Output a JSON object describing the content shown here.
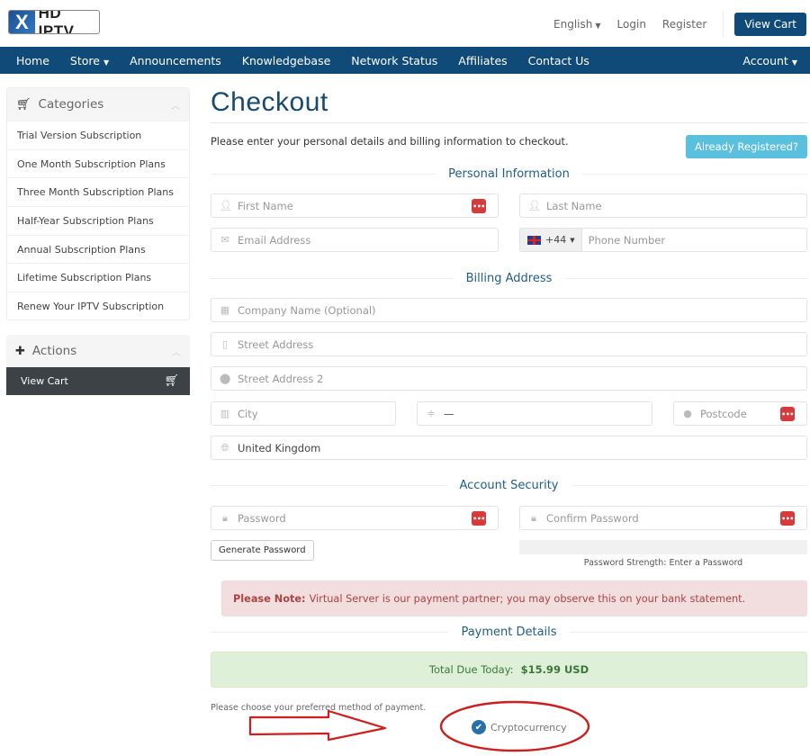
{
  "brand": {
    "logo_mark": "X",
    "logo_text": "HD IPTV"
  },
  "topbar": {
    "language": "English",
    "login": "Login",
    "register": "Register",
    "view_cart": "View Cart"
  },
  "nav": {
    "items": [
      {
        "label": "Home",
        "dropdown": false
      },
      {
        "label": "Store",
        "dropdown": true
      },
      {
        "label": "Announcements",
        "dropdown": false
      },
      {
        "label": "Knowledgebase",
        "dropdown": false
      },
      {
        "label": "Network Status",
        "dropdown": false
      },
      {
        "label": "Affiliates",
        "dropdown": false
      },
      {
        "label": "Contact Us",
        "dropdown": false
      }
    ],
    "account": "Account"
  },
  "sidebar": {
    "categories": {
      "title": "Categories",
      "items": [
        "Trial Version Subscription",
        "One Month Subscription Plans",
        "Three Month Subscription Plans",
        "Half-Year Subscription Plans",
        "Annual Subscription Plans",
        "Lifetime Subscription Plans",
        "Renew Your IPTV Subscription"
      ]
    },
    "actions": {
      "title": "Actions",
      "items": [
        "View Cart"
      ]
    }
  },
  "checkout": {
    "title": "Checkout",
    "intro": "Please enter your personal details and billing information to checkout.",
    "already_registered": "Already Registered?",
    "sections": {
      "personal": "Personal Information",
      "billing": "Billing Address",
      "security": "Account Security",
      "payment": "Payment Details"
    },
    "fields": {
      "first_name": {
        "placeholder": "First Name",
        "value": ""
      },
      "last_name": {
        "placeholder": "Last Name",
        "value": ""
      },
      "email": {
        "placeholder": "Email Address",
        "value": ""
      },
      "phone": {
        "country_code": "+44",
        "placeholder": "Phone Number",
        "value": ""
      },
      "company": {
        "placeholder": "Company Name (Optional)",
        "value": ""
      },
      "street": {
        "placeholder": "Street Address",
        "value": ""
      },
      "street2": {
        "placeholder": "Street Address 2",
        "value": ""
      },
      "city": {
        "placeholder": "City",
        "value": ""
      },
      "state": {
        "value": "—"
      },
      "postcode": {
        "placeholder": "Postcode",
        "value": ""
      },
      "country": {
        "value": "United Kingdom"
      },
      "password": {
        "placeholder": "Password",
        "value": ""
      },
      "confirm_password": {
        "placeholder": "Confirm Password",
        "value": ""
      }
    },
    "generate_password": "Generate Password",
    "password_strength": {
      "label": "Password Strength: Enter a Password",
      "percent": 0
    },
    "note": {
      "label": "Please Note:",
      "text": "Virtual Server is our payment partner; you may observe this on your bank statement."
    },
    "total": {
      "label": "Total Due Today:",
      "amount": "$15.99 USD"
    },
    "payment_prompt": "Please choose your preferred method of payment.",
    "payment_methods": [
      {
        "label": "Cryptocurrency",
        "selected": true
      }
    ]
  },
  "colors": {
    "brand": "#0f4a78",
    "info": "#5bc0de",
    "danger_bg": "#f2dede",
    "success_bg": "#dff0d8",
    "annotation": "#cc1f1f"
  }
}
